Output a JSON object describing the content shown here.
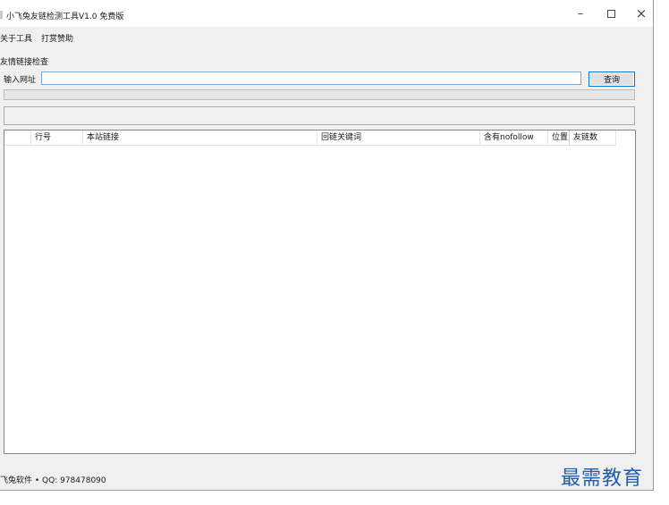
{
  "window": {
    "title": "小飞兔友链检测工具V1.0 免费版"
  },
  "menu": {
    "items": [
      "关于工具",
      "打赏赞助"
    ]
  },
  "section": {
    "label": "友情链接检查"
  },
  "url_form": {
    "label": "输入网址",
    "value": "",
    "placeholder": "",
    "query_button": "查询"
  },
  "progress": {
    "value": 0
  },
  "table": {
    "columns": [
      "",
      "行号",
      "本站链接",
      "回链关键词",
      "含有nofollow",
      "位置",
      "友链数"
    ],
    "rows": []
  },
  "statusbar": {
    "text": "飞兔软件 • QQ: 978478090"
  },
  "watermark": {
    "text": "最需教育",
    "color": "#1f5ea8"
  },
  "colors": {
    "accent": "#0078d7",
    "window_bg": "#f0f0f0"
  }
}
